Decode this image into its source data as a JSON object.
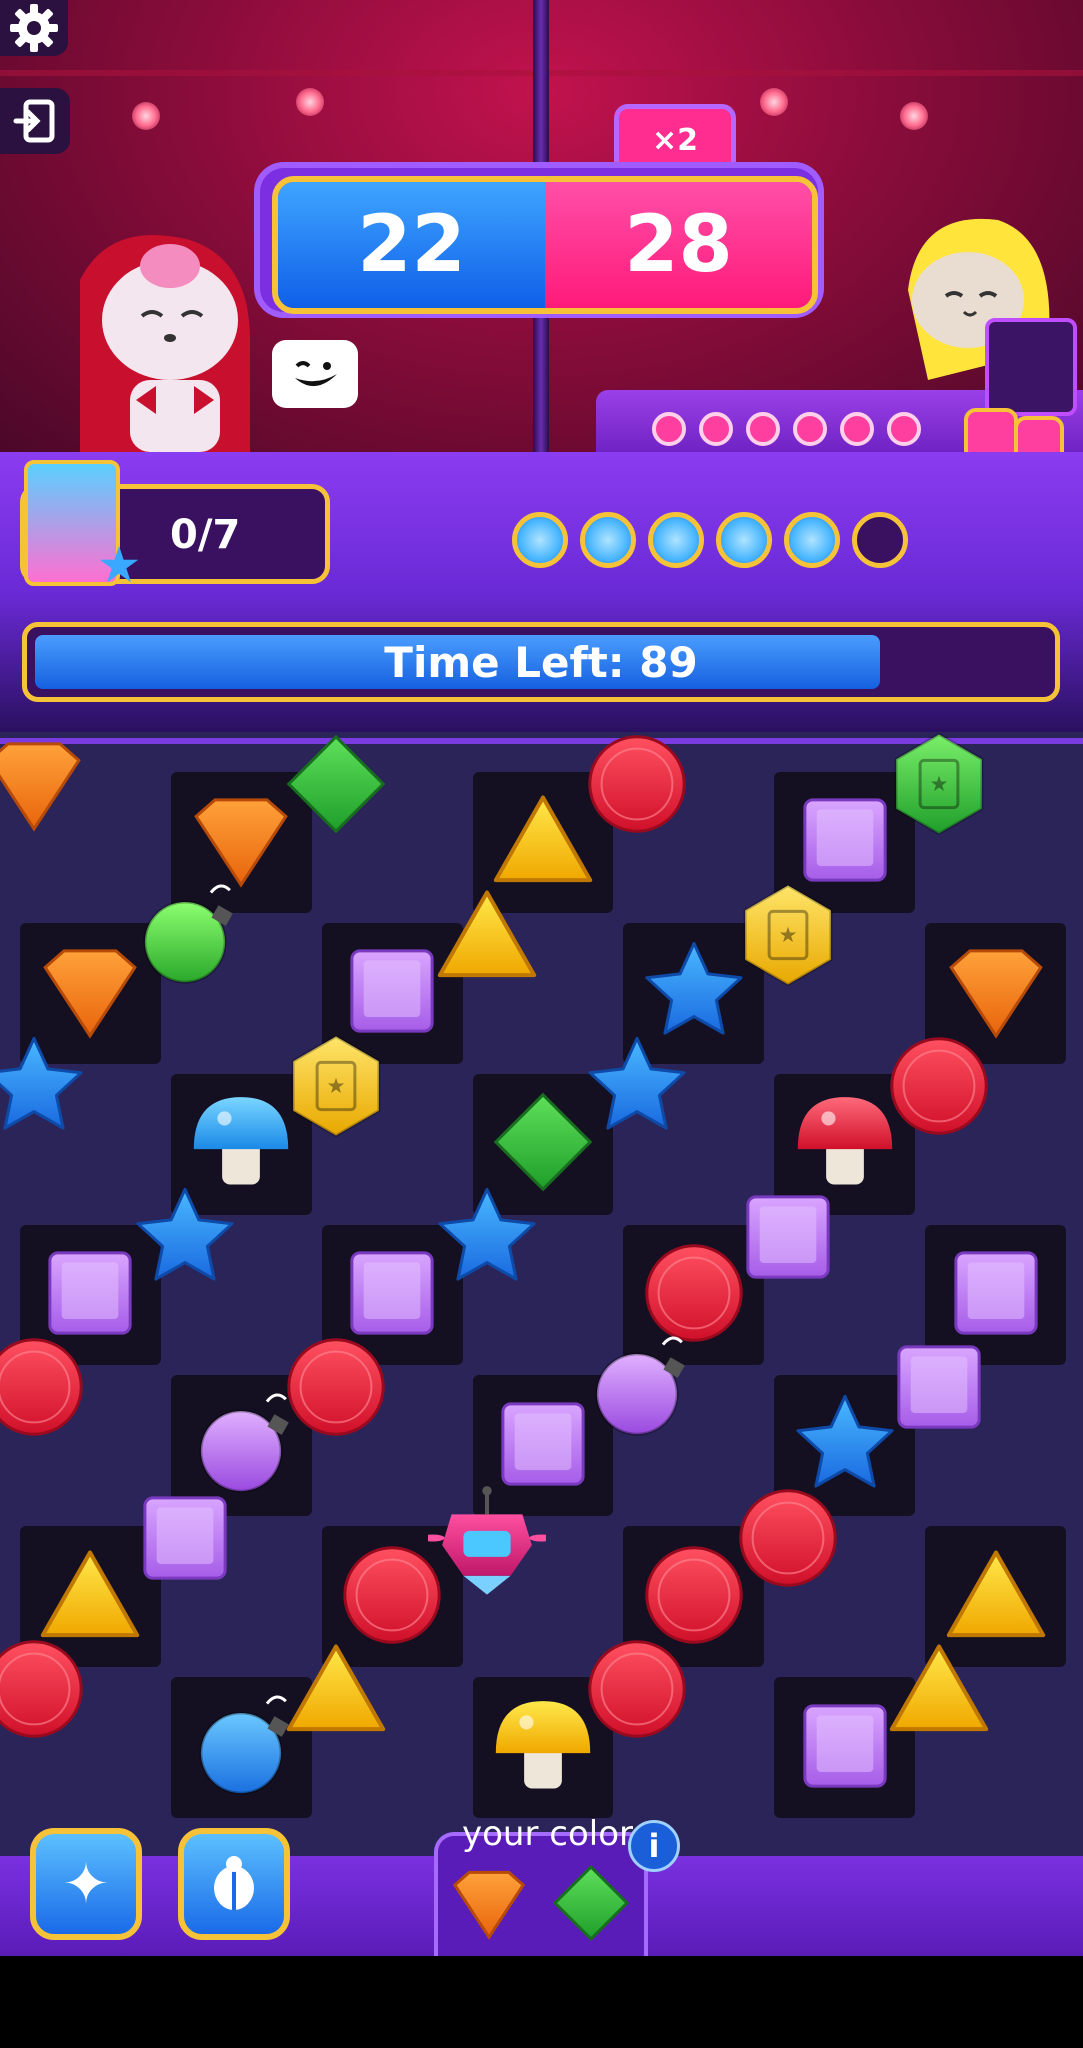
{
  "score": {
    "player": "22",
    "opponent": "28",
    "multiplier": "×2"
  },
  "player": {
    "moves": "0/7",
    "progress_dots": [
      true,
      true,
      true,
      true,
      true,
      false
    ]
  },
  "opponent": {
    "dots": 6
  },
  "timer": {
    "label": "Time Left: 89",
    "fraction": 0.83
  },
  "colors": {
    "label": "your colors",
    "info": "i",
    "gems": [
      "orange",
      "green"
    ]
  },
  "board": [
    [
      "orange",
      "orange",
      "green",
      "yellow",
      "red",
      "purple",
      "green-book"
    ],
    [
      "orange",
      "green-bomb",
      "purple",
      "yellow",
      "blue",
      "gold-book",
      "orange"
    ],
    [
      "blue",
      "blue-mushroom",
      "gold-book",
      "green",
      "blue",
      "red-mushroom",
      "red"
    ],
    [
      "purple",
      "blue",
      "purple",
      "blue",
      "red",
      "purple",
      "purple"
    ],
    [
      "red",
      "purple-bomb",
      "red",
      "purple",
      "purple-bomb",
      "blue",
      "purple"
    ],
    [
      "yellow",
      "purple",
      "red",
      "robot",
      "red",
      "red",
      "yellow"
    ],
    [
      "red",
      "blue-bomb",
      "yellow",
      "yellow-mushroom",
      "red",
      "purple",
      "yellow"
    ]
  ],
  "icons": {
    "settings": "gear-icon",
    "exit": "exit-icon",
    "boost1": "stars-icon",
    "boost2": "scarab-icon"
  }
}
